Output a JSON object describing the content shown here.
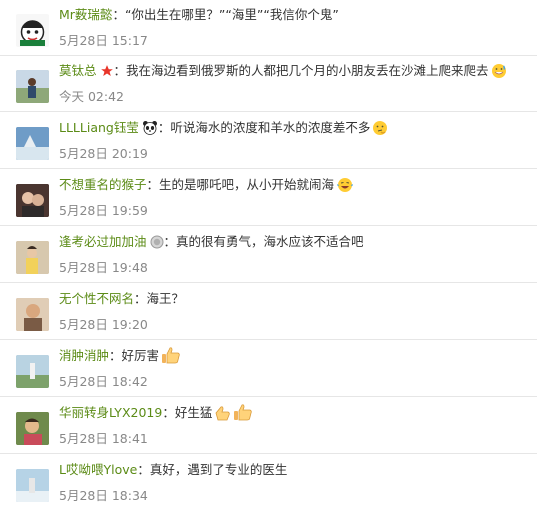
{
  "comments": [
    {
      "user": "Mr薮瑞懿",
      "badge": "",
      "text": "“你出生在哪里？”“海里”“我信你个鬼”",
      "emoji": "",
      "time": "5月28日 15:17",
      "avatar_color": "#f3f3f3"
    },
    {
      "user": "莫钛总",
      "badge": "star-icon",
      "text": "我在海边看到俄罗斯的人都把几个月的小朋友丢在沙滩上爬来爬去",
      "emoji": "grin-sweat-emoji",
      "time": "今天 02:42",
      "avatar_color": "#a9b9a4"
    },
    {
      "user": "LLLLiang钰莹",
      "badge": "panda-icon",
      "text": "听说海水的浓度和羊水的浓度差不多",
      "emoji": "thinking-emoji",
      "time": "5月28日 20:19",
      "avatar_color": "#7fa6c9"
    },
    {
      "user": "不想重名的猴子",
      "badge": "",
      "text": "生的是哪吒吧，从小开始就闹海",
      "emoji": "laugh-cry-emoji",
      "time": "5月28日 19:59",
      "avatar_color": "#6d4a3f"
    },
    {
      "user": "逢考必过加加油",
      "badge": "medal-icon",
      "text": "真的很有勇气，海水应该不适合吧",
      "emoji": "",
      "time": "5月28日 19:48",
      "avatar_color": "#b7a58e"
    },
    {
      "user": "无个性不网名",
      "badge": "",
      "text": "海王？",
      "emoji": "",
      "time": "5月28日 19:20",
      "avatar_color": "#c7a98c"
    },
    {
      "user": "消肿消肿",
      "badge": "",
      "text": "好厉害",
      "emoji": "thumbs-up-emoji",
      "time": "5月28日 18:42",
      "avatar_color": "#9fb7c6"
    },
    {
      "user": "华丽转身LYX2019",
      "badge": "",
      "text": "好生猛",
      "emoji": "clap-thumbs-emoji",
      "time": "5月28日 18:41",
      "avatar_color": "#7d8f5a"
    },
    {
      "user": "L哎呦喂Ylove",
      "badge": "",
      "text": "真好，遇到了专业的医生",
      "emoji": "",
      "time": "5月28日 18:34",
      "avatar_color": "#9cc0d8"
    }
  ],
  "separator": "："
}
